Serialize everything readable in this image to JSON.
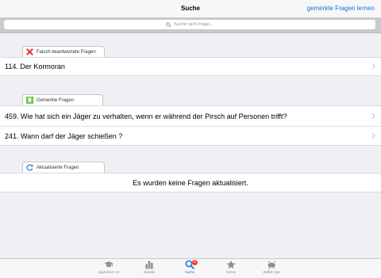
{
  "nav": {
    "title": "Suche",
    "action_label": "gemerkte Fragen lernen"
  },
  "search": {
    "placeholder": "Suche nach Frage..."
  },
  "sections": {
    "wrong": {
      "title": "Falsch beantwortete Fragen",
      "icon": "red-x-icon",
      "items": [
        "114. Der Kormoran"
      ]
    },
    "bookmarked": {
      "title": "Gemerkte Fragen",
      "icon": "green-bookmark-icon",
      "items": [
        "459. Wie hat sich ein Jäger zu verhalten, wenn er während der Pirsch auf Personen trifft?",
        "241. Wann darf der Jäger schießen ?"
      ]
    },
    "updated": {
      "title": "Aktualisierte Fragen",
      "icon": "blue-refresh-icon",
      "empty_message": "Es wurden keine Fragen aktualisiert."
    }
  },
  "tabbar": {
    "items": [
      {
        "label": "Jagdschein SA",
        "icon": "graduation-cap-icon"
      },
      {
        "label": "Statistik",
        "icon": "bar-chart-icon"
      },
      {
        "label": "Suche",
        "icon": "search-icon",
        "badge": "2",
        "active": true
      },
      {
        "label": "Extras",
        "icon": "star-icon"
      },
      {
        "label": "Büffeln Nat",
        "icon": "animal-icon"
      }
    ]
  },
  "colors": {
    "accent": "#1a73e8",
    "background": "#efeff4",
    "badge": "#ff3b30",
    "wrong_icon": "#e53935",
    "bookmark_icon": "#6cc24a",
    "refresh_icon": "#2f7fd6"
  }
}
